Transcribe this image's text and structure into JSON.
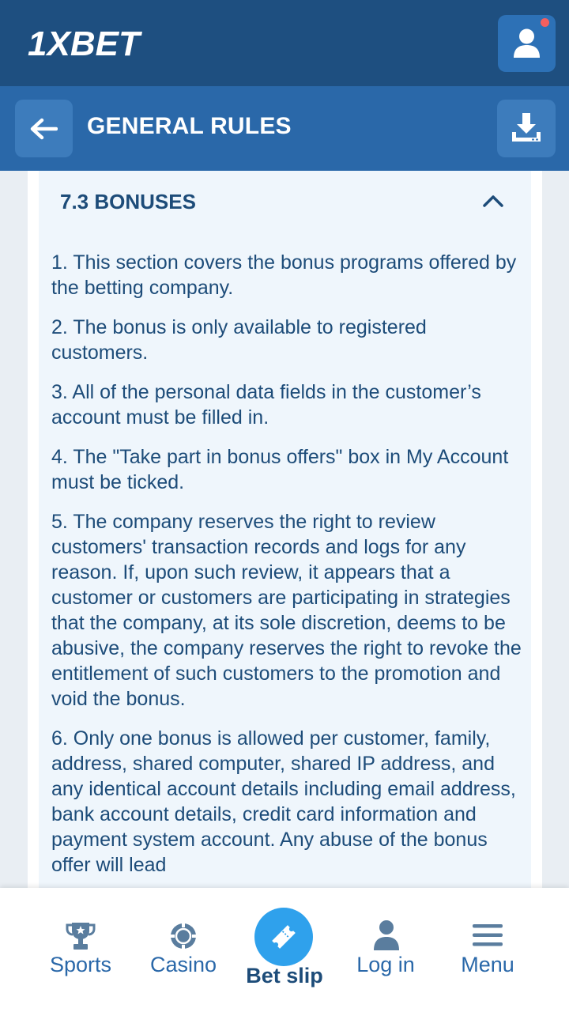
{
  "header": {
    "logo_text": "1XBET",
    "colors": {
      "top": "#1e4f80",
      "sub": "#2a68a9",
      "button": "#3d7cbc",
      "notification": "#f45f5f"
    }
  },
  "subheader": {
    "title": "GENERAL RULES"
  },
  "section": {
    "title": "7.3 BONUSES",
    "rules": [
      "1. This section covers the bonus programs offered by the betting company.",
      "2. The bonus is only available to registered customers.",
      "3. All of the personal data fields in the customer’s account must be filled in.",
      "4. The \"Take part in bonus offers\" box in My Account must be ticked.",
      "5. The company reserves the right to review customers' transaction records and logs for any reason. If, upon such review, it appears that a customer or customers are participating in strategies that the company, at its sole discretion, deems to be abusive, the company reserves the right to revoke the entitlement of such customers to the promotion and void the bonus.",
      "6. Only one bonus is allowed per customer, family, address, shared computer, shared IP address, and any identical account details including email address, bank account details, credit card information and payment system account. Any abuse of the bonus offer will lead"
    ]
  },
  "nav": {
    "sports": "Sports",
    "casino": "Casino",
    "betslip": "Bet slip",
    "login": "Log in",
    "menu": "Menu",
    "accent": "#2fa1ec"
  }
}
